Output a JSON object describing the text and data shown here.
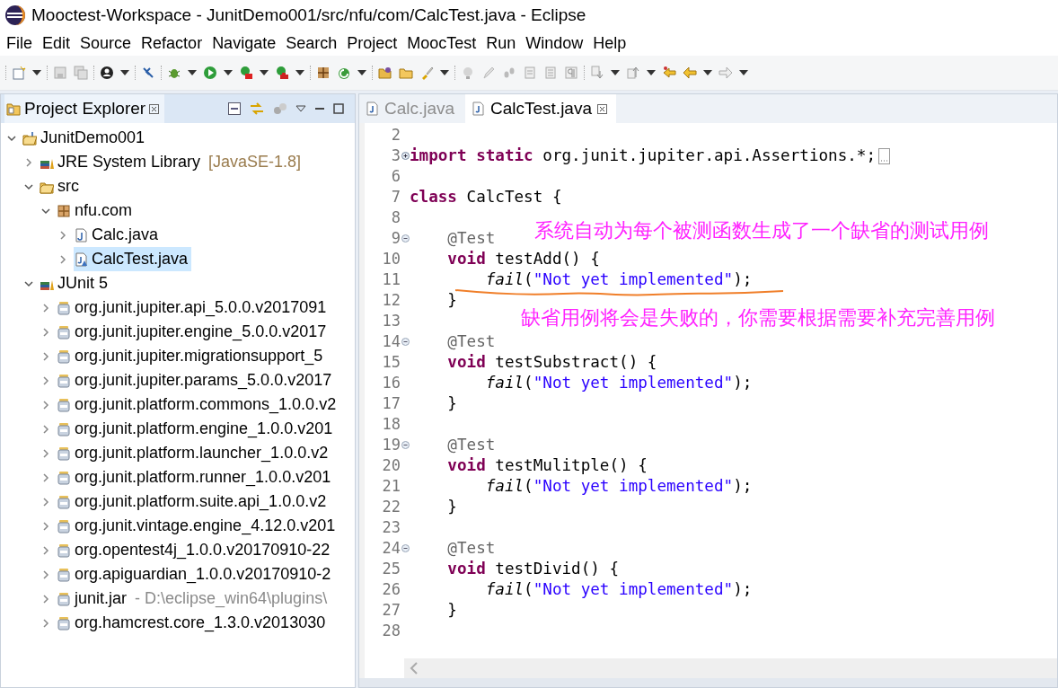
{
  "window": {
    "title": "Mooctest-Workspace - JunitDemo001/src/nfu/com/CalcTest.java - Eclipse"
  },
  "menu": [
    "File",
    "Edit",
    "Source",
    "Refactor",
    "Navigate",
    "Search",
    "Project",
    "MoocTest",
    "Run",
    "Window",
    "Help"
  ],
  "explorer": {
    "title": "Project Explorer",
    "tree": [
      {
        "label": "JunitDemo001",
        "kind": "project",
        "expanded": true,
        "selected": false,
        "children": [
          {
            "label": "JRE System Library",
            "detail": "[JavaSE-1.8]",
            "kind": "library",
            "expanded": false,
            "selected": false
          },
          {
            "label": "src",
            "kind": "source",
            "expanded": true,
            "selected": false,
            "children": [
              {
                "label": "nfu.com",
                "kind": "package",
                "expanded": true,
                "selected": false,
                "children": [
                  {
                    "label": "Calc.java",
                    "kind": "java",
                    "expanded": false,
                    "selected": false
                  },
                  {
                    "label": "CalcTest.java",
                    "kind": "test",
                    "expanded": false,
                    "selected": true
                  }
                ]
              }
            ]
          },
          {
            "label": "JUnit 5",
            "kind": "library",
            "expanded": true,
            "selected": false,
            "children": [
              {
                "label": "org.junit.jupiter.api_5.0.0.v2017091",
                "kind": "jar",
                "expanded": false,
                "selected": false
              },
              {
                "label": "org.junit.jupiter.engine_5.0.0.v2017",
                "kind": "jar",
                "expanded": false,
                "selected": false
              },
              {
                "label": "org.junit.jupiter.migrationsupport_5",
                "kind": "jar",
                "expanded": false,
                "selected": false
              },
              {
                "label": "org.junit.jupiter.params_5.0.0.v2017",
                "kind": "jar",
                "expanded": false,
                "selected": false
              },
              {
                "label": "org.junit.platform.commons_1.0.0.v2",
                "kind": "jar",
                "expanded": false,
                "selected": false
              },
              {
                "label": "org.junit.platform.engine_1.0.0.v201",
                "kind": "jar",
                "expanded": false,
                "selected": false
              },
              {
                "label": "org.junit.platform.launcher_1.0.0.v2",
                "kind": "jar",
                "expanded": false,
                "selected": false
              },
              {
                "label": "org.junit.platform.runner_1.0.0.v201",
                "kind": "jar",
                "expanded": false,
                "selected": false
              },
              {
                "label": "org.junit.platform.suite.api_1.0.0.v2",
                "kind": "jar",
                "expanded": false,
                "selected": false
              },
              {
                "label": "org.junit.vintage.engine_4.12.0.v201",
                "kind": "jar",
                "expanded": false,
                "selected": false
              },
              {
                "label": "org.opentest4j_1.0.0.v20170910-22",
                "kind": "jar",
                "expanded": false,
                "selected": false
              },
              {
                "label": "org.apiguardian_1.0.0.v20170910-2",
                "kind": "jar",
                "expanded": false,
                "selected": false
              },
              {
                "label": "junit.jar",
                "detail": "- D:\\eclipse_win64\\plugins\\",
                "kind": "jar",
                "expanded": false,
                "selected": false
              },
              {
                "label": "org.hamcrest.core_1.3.0.v2013030",
                "kind": "jar",
                "expanded": false,
                "selected": false
              }
            ]
          }
        ]
      }
    ]
  },
  "editor": {
    "tabs": [
      {
        "label": "Calc.java",
        "selected": false
      },
      {
        "label": "CalcTest.java",
        "selected": true
      }
    ],
    "lines": [
      {
        "number": "2"
      },
      {
        "number": "3",
        "collapsed": true,
        "tokens": [
          {
            "kind": "keyword",
            "text": "import "
          },
          {
            "kind": "keyword",
            "text": "static"
          },
          {
            "kind": "plain",
            "text": " org.junit.jupiter.api.Assertions.*;"
          }
        ]
      },
      {
        "number": "6"
      },
      {
        "number": "7",
        "tokens": [
          {
            "kind": "keyword",
            "text": "class"
          },
          {
            "kind": "plain",
            "text": " CalcTest {"
          }
        ]
      },
      {
        "number": "8"
      },
      {
        "number": "9",
        "collapsed": false,
        "tokens": [
          {
            "kind": "annotation",
            "text": "    @Test"
          }
        ]
      },
      {
        "number": "10",
        "tokens": [
          {
            "kind": "keyword",
            "text": "    void"
          },
          {
            "kind": "plain",
            "text": " testAdd() {"
          }
        ]
      },
      {
        "number": "11",
        "tokens": [
          {
            "kind": "static",
            "text": "        fail"
          },
          {
            "kind": "plain",
            "text": "("
          },
          {
            "kind": "string",
            "text": "\"Not yet implemented\""
          },
          {
            "kind": "plain",
            "text": ");"
          }
        ]
      },
      {
        "number": "12",
        "tokens": [
          {
            "kind": "plain",
            "text": "    }"
          }
        ]
      },
      {
        "number": "13"
      },
      {
        "number": "14",
        "collapsed": false,
        "tokens": [
          {
            "kind": "annotation",
            "text": "    @Test"
          }
        ]
      },
      {
        "number": "15",
        "tokens": [
          {
            "kind": "keyword",
            "text": "    void"
          },
          {
            "kind": "plain",
            "text": " testSubstract() {"
          }
        ]
      },
      {
        "number": "16",
        "tokens": [
          {
            "kind": "static",
            "text": "        fail"
          },
          {
            "kind": "plain",
            "text": "("
          },
          {
            "kind": "string",
            "text": "\"Not yet implemented\""
          },
          {
            "kind": "plain",
            "text": ");"
          }
        ]
      },
      {
        "number": "17",
        "tokens": [
          {
            "kind": "plain",
            "text": "    }"
          }
        ]
      },
      {
        "number": "18"
      },
      {
        "number": "19",
        "collapsed": false,
        "tokens": [
          {
            "kind": "annotation",
            "text": "    @Test"
          }
        ]
      },
      {
        "number": "20",
        "tokens": [
          {
            "kind": "keyword",
            "text": "    void"
          },
          {
            "kind": "plain",
            "text": " testMulitple() {"
          }
        ]
      },
      {
        "number": "21",
        "tokens": [
          {
            "kind": "static",
            "text": "        fail"
          },
          {
            "kind": "plain",
            "text": "("
          },
          {
            "kind": "string",
            "text": "\"Not yet implemented\""
          },
          {
            "kind": "plain",
            "text": ");"
          }
        ]
      },
      {
        "number": "22",
        "tokens": [
          {
            "kind": "plain",
            "text": "    }"
          }
        ]
      },
      {
        "number": "23"
      },
      {
        "number": "24",
        "collapsed": false,
        "tokens": [
          {
            "kind": "annotation",
            "text": "    @Test"
          }
        ]
      },
      {
        "number": "25",
        "tokens": [
          {
            "kind": "keyword",
            "text": "    void"
          },
          {
            "kind": "plain",
            "text": " testDivid() {"
          }
        ]
      },
      {
        "number": "26",
        "tokens": [
          {
            "kind": "static",
            "text": "        fail"
          },
          {
            "kind": "plain",
            "text": "("
          },
          {
            "kind": "string",
            "text": "\"Not yet implemented\""
          },
          {
            "kind": "plain",
            "text": ");"
          }
        ]
      },
      {
        "number": "27",
        "tokens": [
          {
            "kind": "plain",
            "text": "    }"
          }
        ]
      },
      {
        "number": "28"
      }
    ],
    "notes": [
      {
        "text": "系统自动为每个被测函数生成了一个缺省的测试用例",
        "color": "#ff21ff"
      },
      {
        "text": "缺省用例将会是失败的，你需要根据需要补充完善用例",
        "color": "#ff21ff"
      }
    ]
  }
}
